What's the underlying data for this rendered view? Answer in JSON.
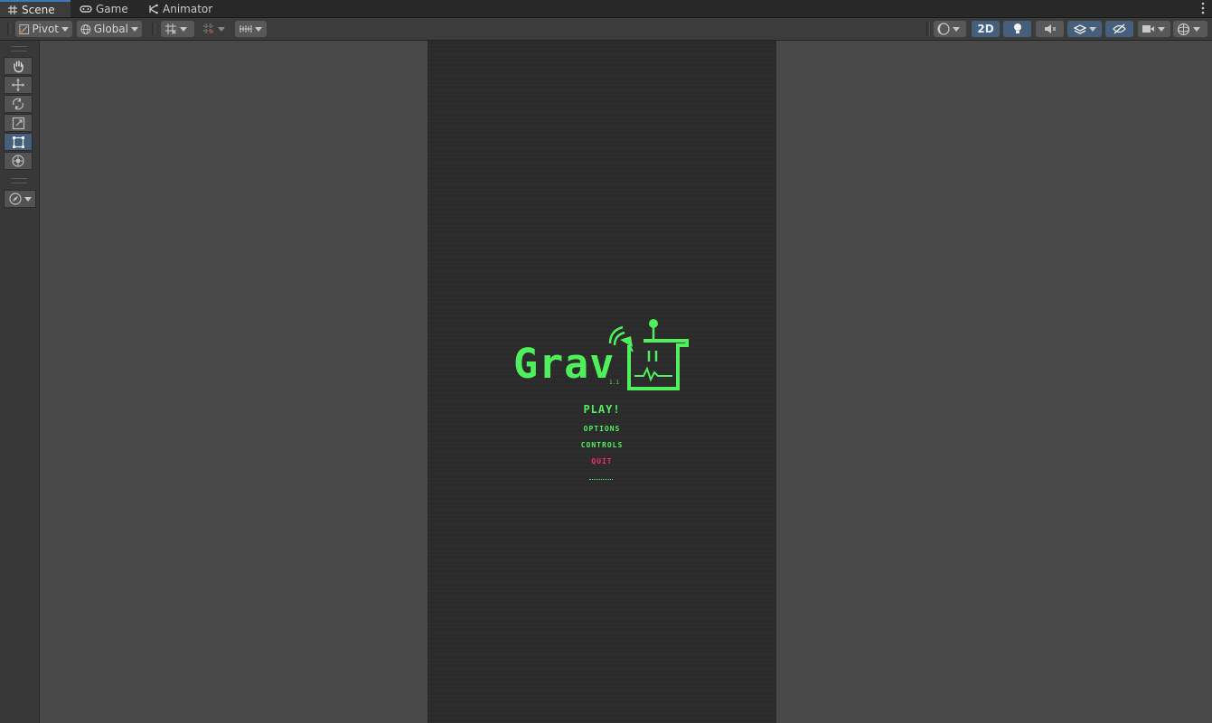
{
  "tabs": [
    {
      "label": "Scene",
      "icon": "grid-icon",
      "active": true
    },
    {
      "label": "Game",
      "icon": "gamepad-icon",
      "active": false
    },
    {
      "label": "Animator",
      "icon": "animator-icon",
      "active": false
    }
  ],
  "toolbar": {
    "pivot_label": "Pivot",
    "global_label": "Global",
    "mode_2d_label": "2D"
  },
  "game": {
    "title": "Grav",
    "version": "1.1",
    "menu": {
      "play": "PLAY!",
      "options": "OPTIONS",
      "controls": "CONTROLS",
      "quit": "QUIT"
    }
  },
  "colors": {
    "accent_blue": "#46607c",
    "tab_highlight": "#3a79bb",
    "game_green": "#4ff05c",
    "quit_red": "#ff2a68",
    "scene_bg": "#484848",
    "canvas_bg": "#2b2b2b"
  }
}
